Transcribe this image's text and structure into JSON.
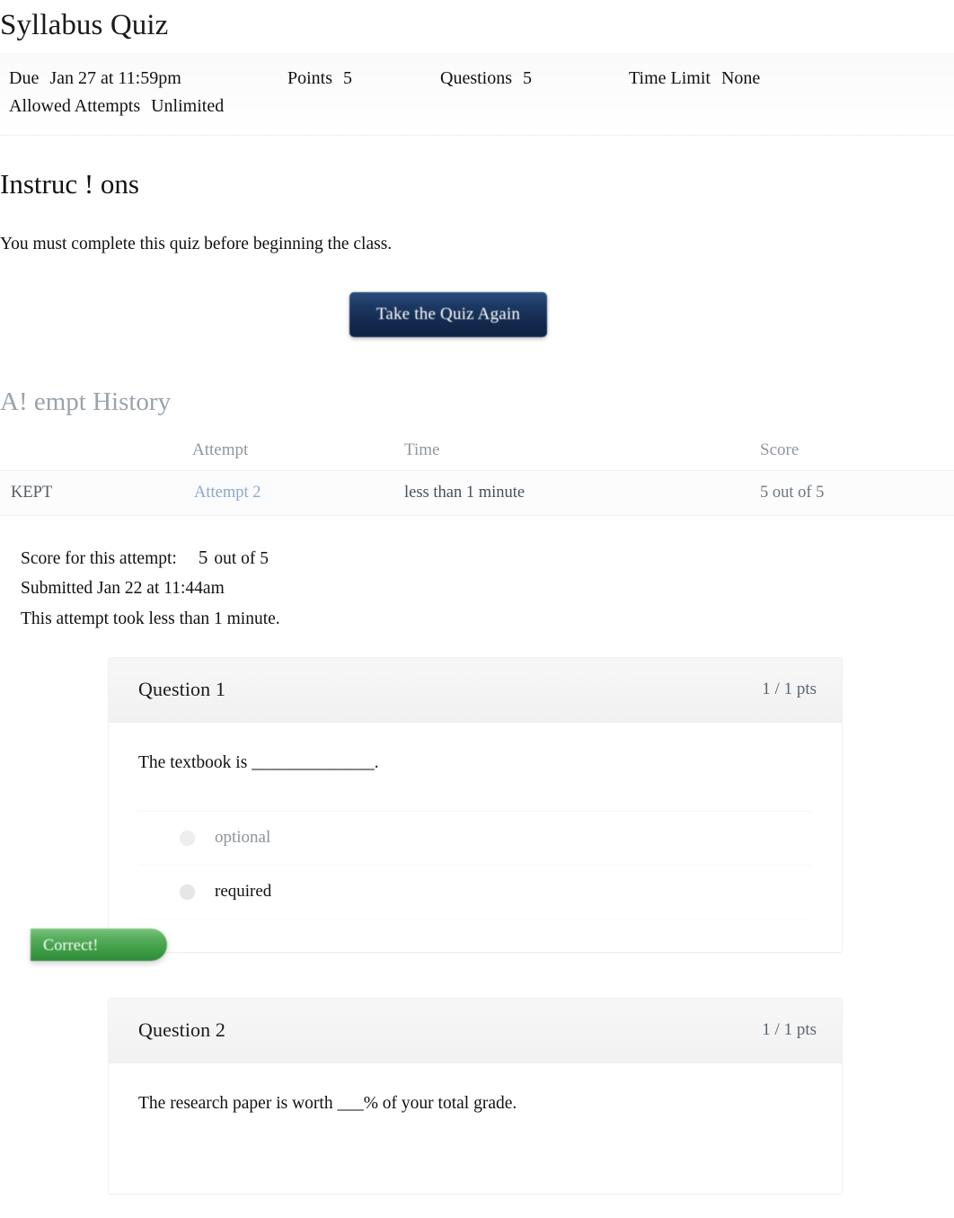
{
  "quiz": {
    "title": "Syllabus Quiz",
    "meta": {
      "due_label": "Due",
      "due_value": "Jan 27 at 11:59pm",
      "points_label": "Points",
      "points_value": "5",
      "questions_label": "Questions",
      "questions_value": "5",
      "time_limit_label": "Time Limit",
      "time_limit_value": "None",
      "allowed_attempts_label": "Allowed Attempts",
      "allowed_attempts_value": "Unlimited"
    },
    "instructions": {
      "heading": "Instruc ! ons",
      "body": "You must complete this quiz before beginning the class."
    },
    "take_quiz_button": "Take the Quiz Again"
  },
  "attempt_history": {
    "heading": "A! empt History",
    "columns": {
      "blank": "",
      "attempt": "Attempt",
      "time": "Time",
      "score": "Score"
    },
    "rows": [
      {
        "kept": "KEPT",
        "attempt": "Attempt 2",
        "time": "less than 1 minute",
        "score": "5 out of 5"
      }
    ]
  },
  "score_summary": {
    "score_label": "Score for this attempt:",
    "score_number": "5",
    "score_outof": "out of 5",
    "submitted": "Submitted Jan 22 at 11:44am",
    "duration": "This attempt took less than 1 minute."
  },
  "questions": [
    {
      "name": "Question 1",
      "points": "1 / 1 pts",
      "text": "The textbook is ______________.",
      "badge": "Correct!",
      "answers": [
        {
          "label": "optional",
          "selected": false
        },
        {
          "label": "required",
          "selected": true
        }
      ]
    },
    {
      "name": "Question 2",
      "points": "1 / 1 pts",
      "text": "The research paper is worth ___% of your total grade.",
      "answers": []
    }
  ],
  "colors": {
    "button_blue": "#1c3963",
    "badge_green": "#3f9e46",
    "link_blue": "#8fa8c9",
    "muted_gray": "#9aa3ab"
  }
}
